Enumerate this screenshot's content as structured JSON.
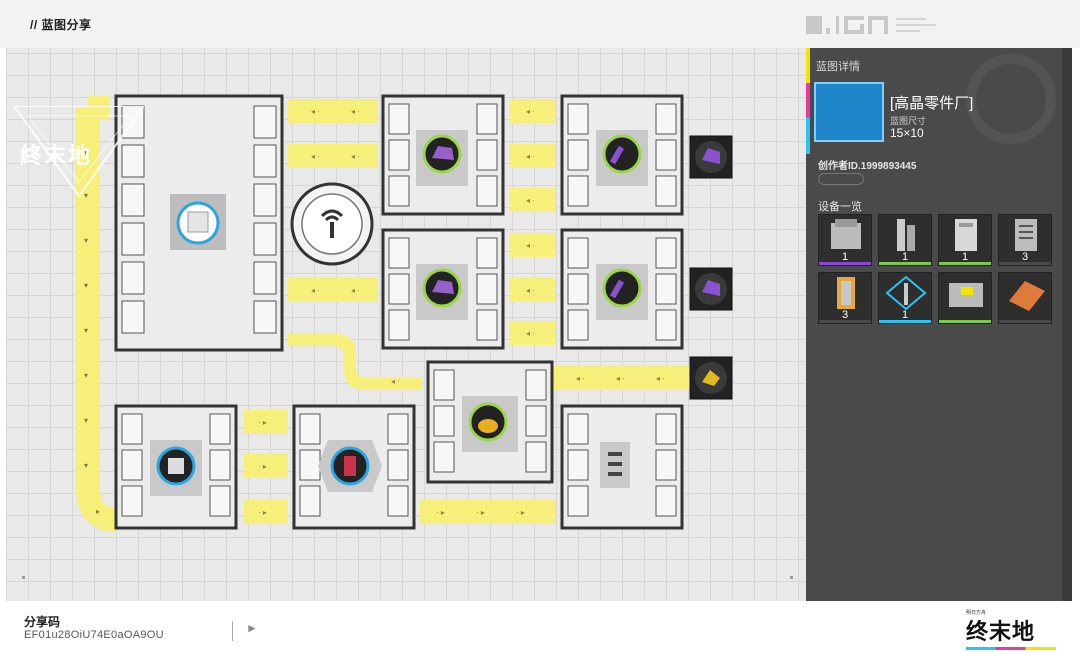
{
  "header": {
    "title": "// 蓝图分享"
  },
  "watermark": {
    "text": "終末地"
  },
  "panel": {
    "section_title": "蓝图详情",
    "blueprint_name": "[高晶零件厂]",
    "size_label": "蓝图尺寸",
    "size_value": "15×10",
    "author": "创作者ID.1999893445",
    "devices_title": "设备一览",
    "devices": [
      {
        "icon": "crusher-device-icon",
        "count": "1",
        "bar": "#8a45d8"
      },
      {
        "icon": "pillar-device-icon",
        "count": "1",
        "bar": "#7ec84a"
      },
      {
        "icon": "refinery-device-icon",
        "count": "1",
        "bar": "#7ec84a"
      },
      {
        "icon": "storage-device-icon",
        "count": "3",
        "bar": "#4a4a4a"
      },
      {
        "icon": "power-pylon-icon",
        "count": "3",
        "bar": "#4a4a4a"
      },
      {
        "icon": "relay-tower-icon",
        "count": "1",
        "bar": "#2ac4f4"
      },
      {
        "icon": "packer-device-icon",
        "count": "",
        "bar": "#7ec84a"
      },
      {
        "icon": "floor-plate-icon",
        "count": "",
        "bar": "#4a4a4a"
      }
    ]
  },
  "share": {
    "label": "分享码",
    "code": "EF01u28OiU74E0aOA9OU"
  },
  "logo": {
    "text": "终末地",
    "subtitle": "明日方舟"
  },
  "colors": {
    "belt": "#f6f07a",
    "accent_yellow": "#f4e400",
    "accent_pink": "#e83a9d",
    "accent_cyan": "#2ac4f4"
  }
}
